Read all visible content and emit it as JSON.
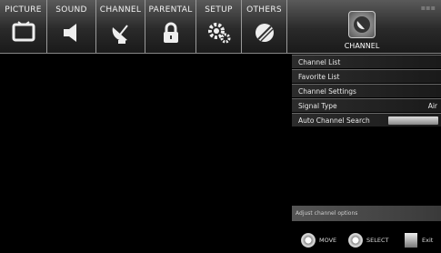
{
  "tabs": [
    {
      "label": "PICTURE",
      "icon": "tv-icon"
    },
    {
      "label": "SOUND",
      "icon": "speaker-icon"
    },
    {
      "label": "CHANNEL",
      "icon": "satellite-dish-icon"
    },
    {
      "label": "PARENTAL",
      "icon": "lock-icon"
    },
    {
      "label": "SETUP",
      "icon": "gears-icon"
    },
    {
      "label": "OTHERS",
      "icon": "others-icon"
    }
  ],
  "active_section": {
    "label": "CHANNEL",
    "icon": "channel-icon"
  },
  "menu": {
    "items": [
      {
        "label": "Channel List",
        "value": ""
      },
      {
        "label": "Favorite List",
        "value": ""
      },
      {
        "label": "Channel Settings",
        "value": ""
      },
      {
        "label": "Signal Type",
        "value": "Air"
      },
      {
        "label": "Auto Channel Search",
        "value": ""
      }
    ]
  },
  "description": "Adjust channel options",
  "hints": [
    {
      "label": "MOVE",
      "icon": "dpad-icon"
    },
    {
      "label": "SELECT",
      "icon": "ok-icon"
    },
    {
      "label": "Exit",
      "icon": "exit-icon"
    }
  ]
}
